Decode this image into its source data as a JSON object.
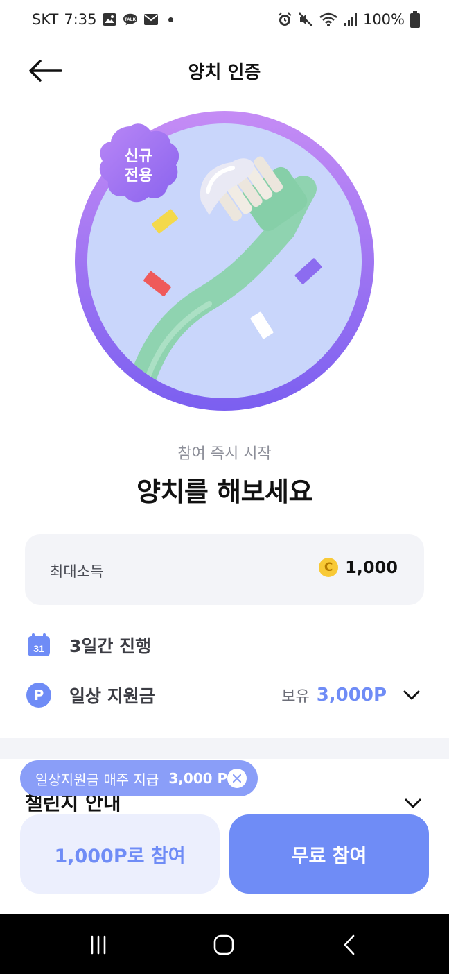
{
  "status_bar": {
    "carrier": "SKT",
    "time": "7:35",
    "battery": "100%",
    "icons": [
      "gallery-icon",
      "talk-icon",
      "mail-icon",
      "alarm-icon",
      "mute-icon",
      "wifi-icon",
      "signal-icon",
      "battery-icon"
    ]
  },
  "header": {
    "title": "양치 인증",
    "back_icon": "arrow-left-icon"
  },
  "hero": {
    "badge_line1": "신규",
    "badge_line2": "전용",
    "colors": {
      "ring_top": "#c58cf5",
      "ring_bottom": "#7b5ff0",
      "disc": "#c9d6fb",
      "badge": "#a472f2"
    }
  },
  "intro": {
    "subtitle": "참여 즉시 시작",
    "headline": "양치를 해보세요"
  },
  "reward": {
    "label": "최대소득",
    "coin_symbol": "C",
    "value": "1,000"
  },
  "info": {
    "duration_day": "31",
    "duration": "3일간 진행",
    "support_symbol": "P",
    "support_label": "일상 지원금",
    "hold_label": "보유",
    "hold_value": "3,000P"
  },
  "guide": {
    "title": "챌린지 안내"
  },
  "tooltip": {
    "text": "일상지원금 매주 지급",
    "amount": "3,000 P"
  },
  "buttons": {
    "points": "1,000P로 참여",
    "free": "무료 참여"
  },
  "colors": {
    "accent": "#6f8cf6",
    "accent_light": "#eceffd",
    "card_bg": "#f3f4f8"
  }
}
